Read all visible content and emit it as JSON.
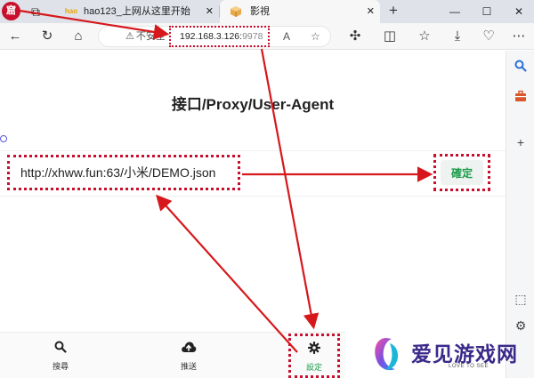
{
  "browser": {
    "app_logo_text": "窟",
    "tabs": [
      {
        "title": "hao123_上网从这里开始",
        "favicon": "hao",
        "close": "✕"
      },
      {
        "title": "影視",
        "favicon": "box-icon",
        "close": "✕"
      }
    ],
    "new_tab": "+",
    "window_controls": {
      "minimize": "—",
      "maximize": "☐",
      "close": "✕"
    },
    "address": {
      "security_label": "不安全",
      "host": "192.168.3.126:",
      "port": "9978"
    }
  },
  "page": {
    "title": "接口/Proxy/User-Agent",
    "input_value": "http://xhww.fun:63/小米/DEMO.json",
    "confirm_label": "確定"
  },
  "bottom_nav": [
    {
      "label": "搜尋",
      "icon": "search-icon"
    },
    {
      "label": "推送",
      "icon": "cloud-upload-icon"
    },
    {
      "label": "設定",
      "icon": "gear-icon"
    }
  ],
  "watermark": {
    "text": "爱见游戏网",
    "subtext": "LOVE TO SEE"
  },
  "colors": {
    "annotation_red": "#c8102e",
    "accent_green": "#1b9c4a",
    "watermark_purple": "#3b2a8a"
  }
}
